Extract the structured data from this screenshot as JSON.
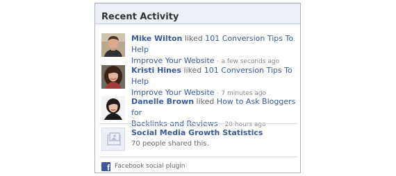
{
  "header": {
    "title": "Recent Activity"
  },
  "activities": [
    {
      "actor": "Mike Wilton",
      "verb": "liked",
      "link_line1": "101 Conversion Tips To Help",
      "link_line2": "Improve Your Website",
      "time": "a few seconds ago"
    },
    {
      "actor": "Kristi Hines",
      "verb": "liked",
      "link_line1": "101 Conversion Tips To Help",
      "link_line2": "Improve Your Website",
      "time": "7 minutes ago"
    },
    {
      "actor": "Danelle Brown",
      "verb": "liked",
      "link_line1": "How to Ask Bloggers for",
      "link_line2": "Backlinks and Reviews",
      "time": "20 hours ago"
    }
  ],
  "recommendation": {
    "title": "Social Media Growth Statistics",
    "count_text": "70 people shared this."
  },
  "footer": {
    "label": "Facebook social plugin"
  },
  "colors": {
    "link": "#3b5998",
    "header_bg": "#eceff5",
    "border": "#aab4c8"
  },
  "icons": {
    "placeholder": "page-placeholder-icon",
    "brand": "facebook-icon"
  }
}
